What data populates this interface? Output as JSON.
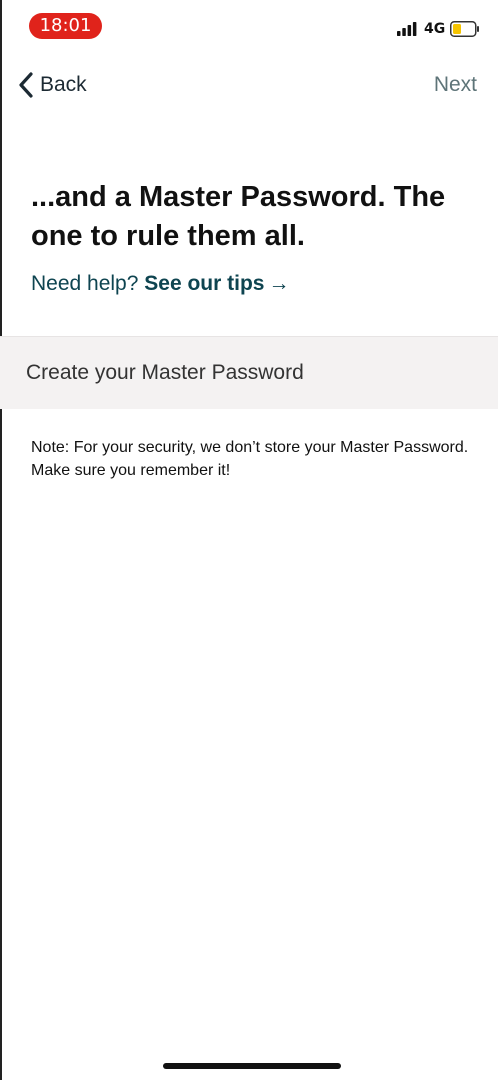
{
  "status_bar": {
    "time": "18:01",
    "network": "4G",
    "icons": [
      "signal-bars-icon",
      "battery-icon"
    ],
    "colors": {
      "time_pill": "#e0231b",
      "battery_fill": "#f5c400"
    }
  },
  "nav": {
    "back_label": "Back",
    "back_icon": "chevron-left-icon",
    "next_label": "Next"
  },
  "headline": "...and a Master Password. The one to rule them all.",
  "help": {
    "prefix": "Need help?",
    "link_label": "See our tips",
    "link_icon": "arrow-right-icon"
  },
  "password_field": {
    "placeholder": "Create your Master Password",
    "value": ""
  },
  "note": "Note: For your security, we don’t store your Master Password. Make sure you remember it!"
}
